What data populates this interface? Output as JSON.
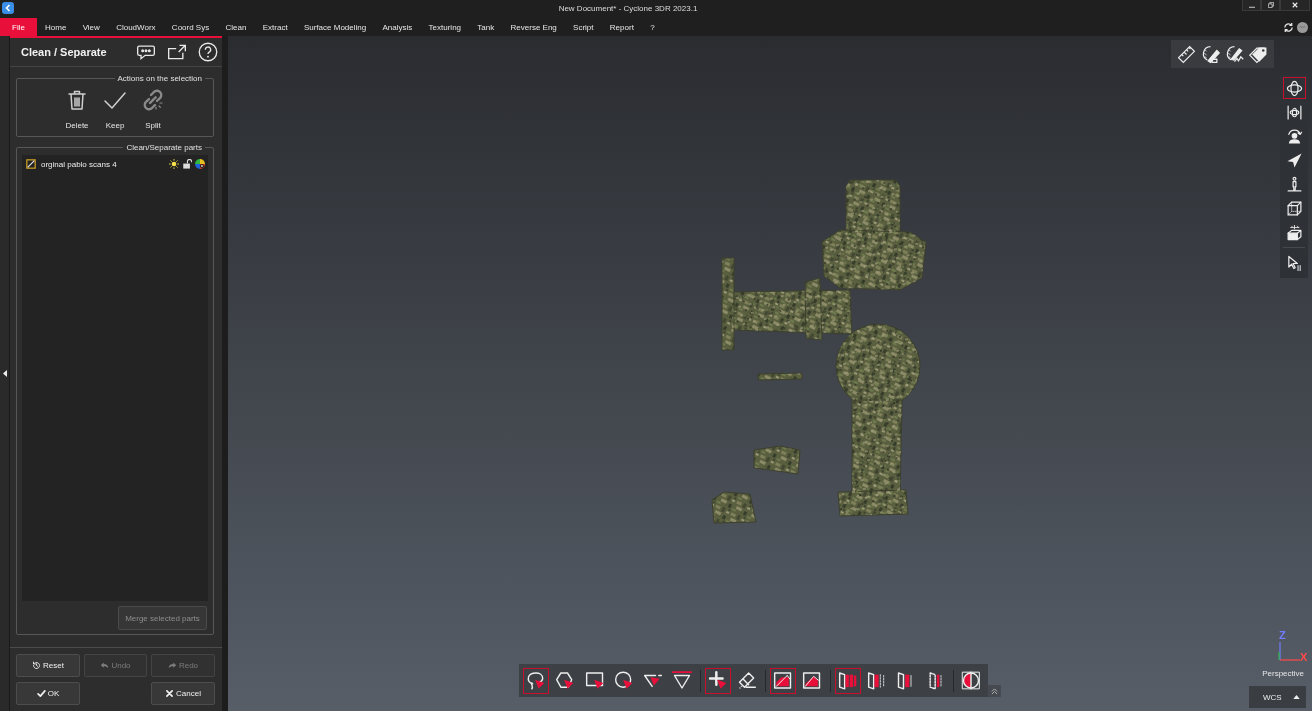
{
  "window": {
    "title": "New Document* - Cyclone 3DR 2023.1"
  },
  "menu": {
    "file_button": "File",
    "tabs": [
      "Home",
      "View",
      "CloudWorx",
      "Coord Sys",
      "Clean",
      "Extract",
      "Surface Modeling",
      "Analysis",
      "Texturing",
      "Tank",
      "Reverse Eng",
      "Script",
      "Report",
      "?"
    ]
  },
  "panel": {
    "title": "Clean / Separate",
    "actions": {
      "title": "Actions on the selection",
      "items": [
        {
          "kind": "delete",
          "label": "Delete",
          "disabled": false
        },
        {
          "kind": "keep",
          "label": "Keep",
          "disabled": false
        },
        {
          "kind": "split",
          "label": "Split",
          "disabled": true
        }
      ]
    },
    "parts": {
      "title": "Clean/Separate parts",
      "items": [
        {
          "name": "orginal pablo scans 4",
          "visible": true,
          "locked": false
        }
      ],
      "merge_button": {
        "label": "Merge selected parts",
        "disabled": true
      }
    },
    "buttons": [
      {
        "kind": "reset",
        "label": "Reset",
        "disabled": false
      },
      {
        "kind": "undo",
        "label": "Undo",
        "disabled": true
      },
      {
        "kind": "redo",
        "label": "Redo",
        "disabled": true
      },
      {
        "kind": "ok",
        "label": "OK",
        "disabled": false
      },
      {
        "kind": "cancel",
        "label": "Cancel",
        "disabled": false
      }
    ]
  },
  "viewport": {
    "navigation_toolbar": {
      "groups": [
        {
          "tools": [
            {
              "kind": "orbit",
              "selected": true
            },
            {
              "kind": "pan",
              "selected": false
            },
            {
              "kind": "examine",
              "selected": false
            },
            {
              "kind": "fly",
              "selected": false
            },
            {
              "kind": "walk",
              "selected": false
            },
            {
              "kind": "cube",
              "selected": false
            },
            {
              "kind": "boxrotate",
              "selected": false
            }
          ]
        },
        {
          "tools": [
            {
              "kind": "cursor",
              "selected": false
            }
          ]
        }
      ]
    },
    "selection_toolbar": {
      "groups": [
        {
          "tools": [
            {
              "kind": "lasso",
              "selected": true
            },
            {
              "kind": "polygon",
              "selected": false
            },
            {
              "kind": "rectangle",
              "selected": false
            },
            {
              "kind": "circle",
              "selected": false
            },
            {
              "kind": "polyline",
              "selected": false
            },
            {
              "kind": "triangle",
              "selected": false
            }
          ]
        },
        {
          "tools": [
            {
              "kind": "point",
              "selected": true
            },
            {
              "kind": "eraser",
              "selected": false
            }
          ]
        },
        {
          "tools": [
            {
              "kind": "cutbox",
              "selected": true
            },
            {
              "kind": "cutboxalt",
              "selected": false
            }
          ]
        },
        {
          "tools": [
            {
              "kind": "stackfour",
              "selected": true
            },
            {
              "kind": "stackthree",
              "selected": false
            },
            {
              "kind": "stacktwo",
              "selected": false
            },
            {
              "kind": "stackone",
              "selected": false
            }
          ]
        },
        {
          "tools": [
            {
              "kind": "invert",
              "selected": false
            }
          ]
        }
      ]
    },
    "axes": [
      {
        "label": "Z",
        "color": "#6f7dff"
      },
      {
        "label": "X",
        "color": "#ff4a4a"
      }
    ],
    "projection": "Perspective",
    "coordinate_system": "WCS"
  }
}
